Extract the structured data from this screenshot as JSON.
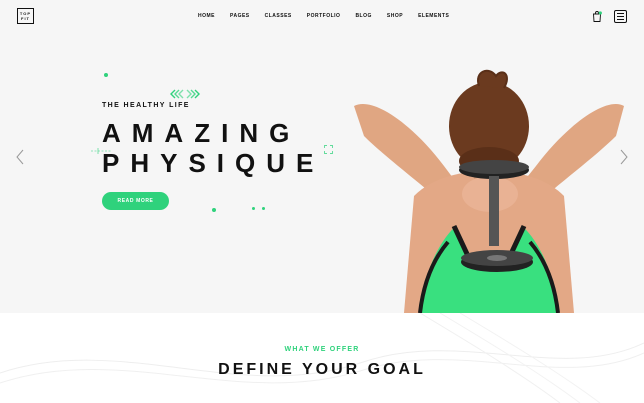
{
  "logo": {
    "line1": "TOP",
    "line2": "FIT"
  },
  "nav": {
    "items": [
      {
        "label": "HOME"
      },
      {
        "label": "PAGES"
      },
      {
        "label": "CLASSES"
      },
      {
        "label": "PORTFOLIO"
      },
      {
        "label": "BLOG"
      },
      {
        "label": "SHOP"
      },
      {
        "label": "ELEMENTS"
      }
    ]
  },
  "header_icons": {
    "cart": "shopping-bag-icon",
    "menu": "hamburger-menu-icon"
  },
  "hero": {
    "tagline": "THE HEALTHY LIFE",
    "title_line1": "AMAZING",
    "title_line2": "PHYSIQUE",
    "button_label": "READ MORE",
    "image": "woman-with-dumbbell"
  },
  "offer": {
    "subtitle": "WHAT WE OFFER",
    "title": "DEFINE YOUR GOAL"
  },
  "colors": {
    "accent": "#2fd27c",
    "text": "#111111",
    "hero_bg": "#f6f6f6"
  }
}
